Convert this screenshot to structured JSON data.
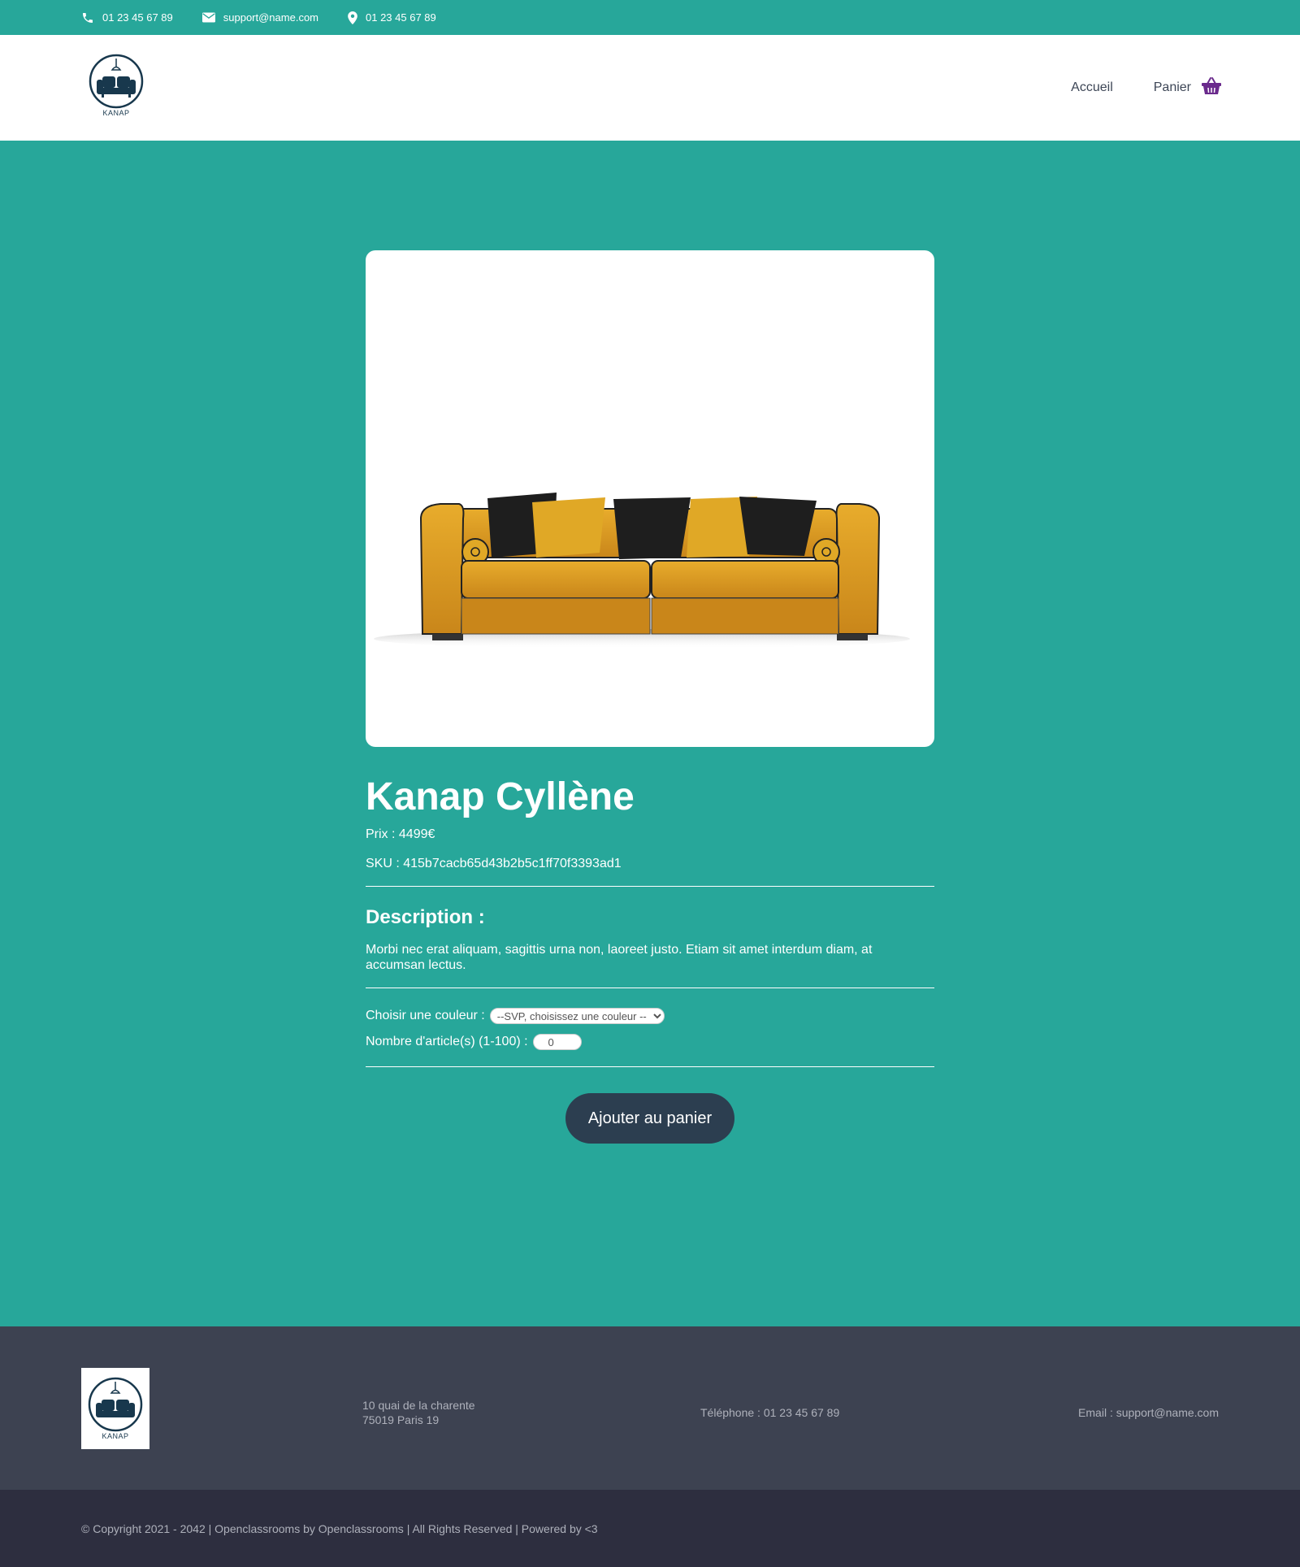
{
  "topbar": {
    "phone": "01 23 45 67 89",
    "email": "support@name.com",
    "location": "01 23 45 67 89"
  },
  "header": {
    "logo_text": "KANAP",
    "nav": {
      "home": "Accueil",
      "cart": "Panier"
    }
  },
  "product": {
    "name": "Kanap Cyllène",
    "price_line": "Prix : 4499€",
    "sku_line": "SKU : 415b7cacb65d43b2b5c1ff70f3393ad1",
    "description_title": "Description :",
    "description": "Morbi nec erat aliquam, sagittis urna non, laoreet justo. Etiam sit amet interdum diam, at accumsan lectus.",
    "color_label": "Choisir une couleur :",
    "color_selected": "--SVP, choisissez une couleur --",
    "quantity_label": "Nombre d'article(s) (1-100) :",
    "quantity_value": "0",
    "add_button": "Ajouter au panier"
  },
  "footer": {
    "logo_text": "KANAP",
    "address_line1": "10 quai de la charente",
    "address_line2": "75019 Paris 19",
    "phone": "Téléphone : 01 23 45 67 89",
    "email": "Email : support@name.com",
    "copyright": "© Copyright 2021 - 2042 | Openclassrooms by Openclassrooms | All Rights Reserved | Powered by <3"
  },
  "colors": {
    "teal": "#27a79a",
    "footer": "#3d4251",
    "bottombar": "#2d2e3f",
    "button": "#2c3e50",
    "cart_icon": "#6a2a8c",
    "sofa": "#d89b1c"
  },
  "icons": [
    "phone-icon",
    "mail-icon",
    "location-icon",
    "cart-icon"
  ]
}
